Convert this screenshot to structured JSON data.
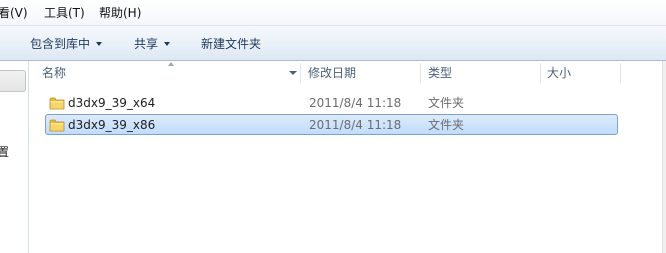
{
  "menu": {
    "view": "看(V)",
    "tools": "工具(T)",
    "help": "帮助(H)"
  },
  "toolbar": {
    "include_in_library": "包含到库中",
    "share": "共享",
    "new_folder": "新建文件夹"
  },
  "navpane": {
    "partial_label": "置"
  },
  "columns": {
    "name": "名称",
    "date_modified": "修改日期",
    "type": "类型",
    "size": "大小"
  },
  "files": [
    {
      "name": "d3dx9_39_x64",
      "date": "2011/8/4 11:18",
      "type": "文件夹",
      "selected": false
    },
    {
      "name": "d3dx9_39_x86",
      "date": "2011/8/4 11:18",
      "type": "文件夹",
      "selected": true
    }
  ],
  "colors": {
    "selection_fill": "#cce4fc",
    "selection_border": "#7da2ce",
    "toolbar_text": "#1e395b",
    "header_text": "#4c607a",
    "folder_yellow": "#f3c94a"
  },
  "icons": {
    "folder": "folder-icon",
    "dropdown": "chevron-down-icon",
    "sort": "sort-up-icon"
  }
}
